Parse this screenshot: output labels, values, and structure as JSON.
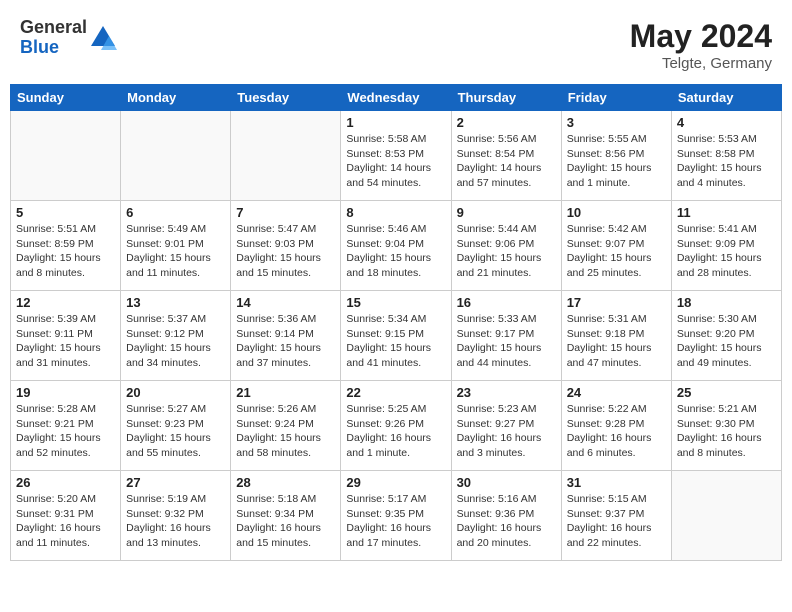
{
  "header": {
    "logo_general": "General",
    "logo_blue": "Blue",
    "month_year": "May 2024",
    "location": "Telgte, Germany"
  },
  "weekdays": [
    "Sunday",
    "Monday",
    "Tuesday",
    "Wednesday",
    "Thursday",
    "Friday",
    "Saturday"
  ],
  "weeks": [
    [
      {
        "day": "",
        "info": ""
      },
      {
        "day": "",
        "info": ""
      },
      {
        "day": "",
        "info": ""
      },
      {
        "day": "1",
        "info": "Sunrise: 5:58 AM\nSunset: 8:53 PM\nDaylight: 14 hours\nand 54 minutes."
      },
      {
        "day": "2",
        "info": "Sunrise: 5:56 AM\nSunset: 8:54 PM\nDaylight: 14 hours\nand 57 minutes."
      },
      {
        "day": "3",
        "info": "Sunrise: 5:55 AM\nSunset: 8:56 PM\nDaylight: 15 hours\nand 1 minute."
      },
      {
        "day": "4",
        "info": "Sunrise: 5:53 AM\nSunset: 8:58 PM\nDaylight: 15 hours\nand 4 minutes."
      }
    ],
    [
      {
        "day": "5",
        "info": "Sunrise: 5:51 AM\nSunset: 8:59 PM\nDaylight: 15 hours\nand 8 minutes."
      },
      {
        "day": "6",
        "info": "Sunrise: 5:49 AM\nSunset: 9:01 PM\nDaylight: 15 hours\nand 11 minutes."
      },
      {
        "day": "7",
        "info": "Sunrise: 5:47 AM\nSunset: 9:03 PM\nDaylight: 15 hours\nand 15 minutes."
      },
      {
        "day": "8",
        "info": "Sunrise: 5:46 AM\nSunset: 9:04 PM\nDaylight: 15 hours\nand 18 minutes."
      },
      {
        "day": "9",
        "info": "Sunrise: 5:44 AM\nSunset: 9:06 PM\nDaylight: 15 hours\nand 21 minutes."
      },
      {
        "day": "10",
        "info": "Sunrise: 5:42 AM\nSunset: 9:07 PM\nDaylight: 15 hours\nand 25 minutes."
      },
      {
        "day": "11",
        "info": "Sunrise: 5:41 AM\nSunset: 9:09 PM\nDaylight: 15 hours\nand 28 minutes."
      }
    ],
    [
      {
        "day": "12",
        "info": "Sunrise: 5:39 AM\nSunset: 9:11 PM\nDaylight: 15 hours\nand 31 minutes."
      },
      {
        "day": "13",
        "info": "Sunrise: 5:37 AM\nSunset: 9:12 PM\nDaylight: 15 hours\nand 34 minutes."
      },
      {
        "day": "14",
        "info": "Sunrise: 5:36 AM\nSunset: 9:14 PM\nDaylight: 15 hours\nand 37 minutes."
      },
      {
        "day": "15",
        "info": "Sunrise: 5:34 AM\nSunset: 9:15 PM\nDaylight: 15 hours\nand 41 minutes."
      },
      {
        "day": "16",
        "info": "Sunrise: 5:33 AM\nSunset: 9:17 PM\nDaylight: 15 hours\nand 44 minutes."
      },
      {
        "day": "17",
        "info": "Sunrise: 5:31 AM\nSunset: 9:18 PM\nDaylight: 15 hours\nand 47 minutes."
      },
      {
        "day": "18",
        "info": "Sunrise: 5:30 AM\nSunset: 9:20 PM\nDaylight: 15 hours\nand 49 minutes."
      }
    ],
    [
      {
        "day": "19",
        "info": "Sunrise: 5:28 AM\nSunset: 9:21 PM\nDaylight: 15 hours\nand 52 minutes."
      },
      {
        "day": "20",
        "info": "Sunrise: 5:27 AM\nSunset: 9:23 PM\nDaylight: 15 hours\nand 55 minutes."
      },
      {
        "day": "21",
        "info": "Sunrise: 5:26 AM\nSunset: 9:24 PM\nDaylight: 15 hours\nand 58 minutes."
      },
      {
        "day": "22",
        "info": "Sunrise: 5:25 AM\nSunset: 9:26 PM\nDaylight: 16 hours\nand 1 minute."
      },
      {
        "day": "23",
        "info": "Sunrise: 5:23 AM\nSunset: 9:27 PM\nDaylight: 16 hours\nand 3 minutes."
      },
      {
        "day": "24",
        "info": "Sunrise: 5:22 AM\nSunset: 9:28 PM\nDaylight: 16 hours\nand 6 minutes."
      },
      {
        "day": "25",
        "info": "Sunrise: 5:21 AM\nSunset: 9:30 PM\nDaylight: 16 hours\nand 8 minutes."
      }
    ],
    [
      {
        "day": "26",
        "info": "Sunrise: 5:20 AM\nSunset: 9:31 PM\nDaylight: 16 hours\nand 11 minutes."
      },
      {
        "day": "27",
        "info": "Sunrise: 5:19 AM\nSunset: 9:32 PM\nDaylight: 16 hours\nand 13 minutes."
      },
      {
        "day": "28",
        "info": "Sunrise: 5:18 AM\nSunset: 9:34 PM\nDaylight: 16 hours\nand 15 minutes."
      },
      {
        "day": "29",
        "info": "Sunrise: 5:17 AM\nSunset: 9:35 PM\nDaylight: 16 hours\nand 17 minutes."
      },
      {
        "day": "30",
        "info": "Sunrise: 5:16 AM\nSunset: 9:36 PM\nDaylight: 16 hours\nand 20 minutes."
      },
      {
        "day": "31",
        "info": "Sunrise: 5:15 AM\nSunset: 9:37 PM\nDaylight: 16 hours\nand 22 minutes."
      },
      {
        "day": "",
        "info": ""
      }
    ]
  ]
}
